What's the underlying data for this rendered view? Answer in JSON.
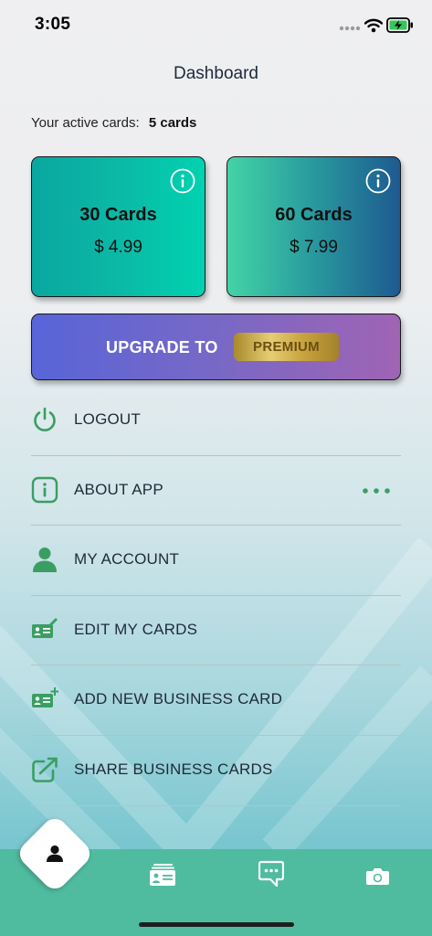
{
  "status_bar": {
    "time": "3:05"
  },
  "header": {
    "title": "Dashboard"
  },
  "active_cards": {
    "label": "Your active cards:",
    "count": "5 cards"
  },
  "plans": [
    {
      "name": "30 Cards",
      "price": "$ 4.99"
    },
    {
      "name": "60 Cards",
      "price": "$ 7.99"
    }
  ],
  "upgrade": {
    "label": "UPGRADE TO",
    "badge": "PREMIUM"
  },
  "menu": {
    "items": [
      {
        "label": "LOGOUT",
        "icon": "power-icon"
      },
      {
        "label": "ABOUT APP",
        "icon": "info-icon"
      },
      {
        "label": "MY ACCOUNT",
        "icon": "user-icon"
      },
      {
        "label": "EDIT MY CARDS",
        "icon": "edit-card-icon"
      },
      {
        "label": "ADD NEW BUSINESS CARD",
        "icon": "add-card-icon"
      },
      {
        "label": "SHARE BUSINESS CARDS",
        "icon": "share-icon"
      }
    ]
  },
  "tabbar": {
    "tabs": [
      {
        "icon": "profile-icon",
        "selected": true
      },
      {
        "icon": "cards-icon",
        "selected": false
      },
      {
        "icon": "chat-icon",
        "selected": false
      },
      {
        "icon": "camera-icon",
        "selected": false
      }
    ]
  },
  "colors": {
    "accent_green": "#3a9e63",
    "tabbar": "#4fbca0",
    "premium_gold": "#d4b552"
  }
}
